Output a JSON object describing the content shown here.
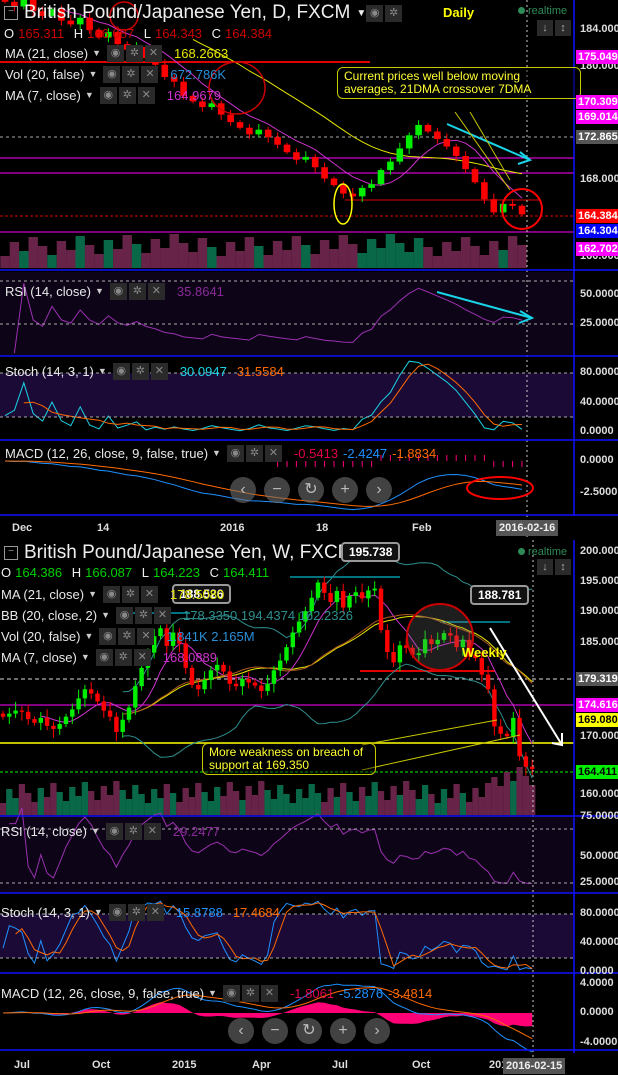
{
  "daily": {
    "title": "British Pound/Japanese Yen, D, FXCM",
    "timeframe_label": "Daily",
    "realtime": "realtime",
    "ohlc": {
      "o_label": "O",
      "o": "165.311",
      "h_label": "H",
      "h": "166.087",
      "l_label": "L",
      "l": "164.343",
      "c_label": "C",
      "c": "164.384"
    },
    "indicators": [
      {
        "label": "MA (21, close)",
        "value": "168.2663",
        "color": "#e6e600"
      },
      {
        "label": "Vol (20, false)",
        "value": "672.786K",
        "color": "#2a8fd8"
      },
      {
        "label": "MA (7, close)",
        "value": "164.9679",
        "color": "#cc33cc"
      }
    ],
    "rsi": {
      "label": "RSI (14, close)",
      "value": "35.8641"
    },
    "stoch": {
      "label": "Stoch (14, 3, 1)",
      "k": "30.0947",
      "d": "31.5584"
    },
    "macd": {
      "label": "MACD (12, 26, close, 9, false, true)",
      "hist": "-0.5413",
      "macd": "-2.4247",
      "signal": "-1.8834"
    },
    "annotation": "Current prices well below moving averages, 21DMA crossover 7DMA",
    "price_axis": [
      "184.000",
      "180.000",
      "172.000",
      "168.000",
      "160.000"
    ],
    "price_tags": [
      {
        "value": "175.049",
        "bg": "#ff00ff",
        "fg": "#ffffff"
      },
      {
        "value": "170.309",
        "bg": "#ff00ff",
        "fg": "#ffffff"
      },
      {
        "value": "169.014",
        "bg": "#ff00ff",
        "fg": "#ffffff"
      },
      {
        "value": "172.865",
        "bg": "#555555",
        "fg": "#ffffff"
      },
      {
        "value": "164.384",
        "bg": "#ff0000",
        "fg": "#ffffff"
      },
      {
        "value": "164.304",
        "bg": "#0000ff",
        "fg": "#ffffff"
      },
      {
        "value": "162.702",
        "bg": "#ff00ff",
        "fg": "#ffffff"
      }
    ],
    "rsi_axis": [
      "50.0000",
      "25.0000"
    ],
    "stoch_axis": [
      "80.0000",
      "40.0000",
      "0.0000"
    ],
    "macd_axis": [
      "0.0000",
      "-2.5000"
    ],
    "date_axis": [
      "Dec",
      "14",
      "2016",
      "18",
      "Feb"
    ],
    "cursor_date": "2016-02-16",
    "chart_data": {
      "type": "candlestick",
      "closes": [
        187,
        186.5,
        187.2,
        186,
        185.5,
        186.2,
        185,
        184.6,
        185.3,
        184,
        183.2,
        183.8,
        182.5,
        181.9,
        182.2,
        181,
        180.3,
        179,
        178.5,
        177,
        176.4,
        175.8,
        176.2,
        175,
        174.2,
        173.6,
        172.9,
        173.4,
        172.6,
        171.8,
        171,
        170.2,
        170.5,
        169.4,
        168.2,
        167.5,
        166.6,
        166.3,
        167.2,
        167.6,
        169.1,
        170,
        171.4,
        172.8,
        173.9,
        173.2,
        172.4,
        171.6,
        170.6,
        169.2,
        167.8,
        166,
        164.6,
        165.5,
        165.3,
        164.384
      ]
    }
  },
  "weekly": {
    "title": "British Pound/Japanese Yen, W, FXCM",
    "timeframe_label": "Weekly",
    "realtime": "realtime",
    "ohlc": {
      "o_label": "O",
      "o": "164.386",
      "h_label": "H",
      "h": "166.087",
      "l_label": "L",
      "l": "164.223",
      "c_label": "C",
      "c": "164.411"
    },
    "indicators": [
      {
        "label": "MA (21, close)",
        "value": "178.5080",
        "color": "#e6e600"
      },
      {
        "label": "BB (20, close, 2)",
        "value": "178.3350  194.4374  162.2326",
        "color": "#2f8f8f"
      },
      {
        "label": "Vol (20, false)",
        "value": "1.841K  2.165M",
        "color": "#2a8fd8"
      },
      {
        "label": "MA (7, close)",
        "value": "168.0889",
        "color": "#cc33cc"
      }
    ],
    "rsi": {
      "label": "RSI (14, close)",
      "value": "29.2477"
    },
    "stoch": {
      "label": "Stoch (14, 3, 1)",
      "k": "15.8788",
      "d": "17.4684"
    },
    "macd": {
      "label": "MACD (12, 26, close, 9, false, true)",
      "hist": "-1.8061",
      "macd": "-5.2876",
      "signal": "-3.4814"
    },
    "callouts": [
      "188.526",
      "195.738",
      "188.781"
    ],
    "annotation": "More weakness on breach of support at 169.350",
    "price_axis": [
      "200.000",
      "195.000",
      "190.000",
      "185.000",
      "170.000",
      "160.000"
    ],
    "price_tags": [
      {
        "value": "179.319",
        "bg": "#555555",
        "fg": "#ffffff"
      },
      {
        "value": "174.616",
        "bg": "#ff00ff",
        "fg": "#ffffff"
      },
      {
        "value": "169.080",
        "bg": "#ffff00",
        "fg": "#000000"
      },
      {
        "value": "164.411",
        "bg": "#00ee00",
        "fg": "#000000"
      }
    ],
    "rsi_axis": [
      "75.0000",
      "50.0000",
      "25.0000"
    ],
    "stoch_axis": [
      "80.0000",
      "40.0000",
      "0.0000"
    ],
    "macd_axis": [
      "4.0000",
      "0.0000",
      "-4.0000"
    ],
    "date_axis": [
      "Jul",
      "Oct",
      "2015",
      "Apr",
      "Jul",
      "Oct",
      "2016"
    ],
    "cursor_date": "2016-02-15",
    "chart_data": {
      "type": "candlestick",
      "closes": [
        173,
        173.5,
        174,
        173.8,
        172.6,
        172,
        172.8,
        171.5,
        171,
        171.8,
        173,
        174.2,
        176,
        177.5,
        176.8,
        175.5,
        174,
        173,
        170.5,
        172.5,
        174.5,
        178,
        181,
        183.5,
        186.2,
        187.5,
        184.6,
        186.8,
        185,
        181,
        178.2,
        177.5,
        179,
        180.6,
        181.5,
        180.4,
        178.4,
        178,
        179.2,
        178.6,
        178.1,
        177.2,
        178.4,
        180.6,
        182.2,
        184.4,
        186.8,
        188.6,
        190.3,
        192.5,
        195,
        193.3,
        191.8,
        193.6,
        190.9,
        192.8,
        193.4,
        192.4,
        193.7,
        194,
        187.2,
        183.6,
        181.9,
        184.7,
        184.3,
        183.1,
        183.4,
        185.7,
        184.9,
        185.6,
        186.7,
        186.3,
        184.4,
        185.6,
        183.2,
        182.6,
        179.9,
        177.5,
        171.4,
        170.2,
        169.8,
        172.8,
        166.5,
        164.8,
        164.411
      ]
    }
  },
  "nav": {
    "prev": "‹",
    "zoom_out": "−",
    "reset": "↻",
    "zoom_in": "+",
    "next": "›"
  },
  "colors": {
    "up": "#00ee00",
    "down": "#ff0000",
    "axis": "#0000ff",
    "rsi": "#9b30b0",
    "stoch_k": "#1e90ff",
    "stoch_d": "#ff6a00",
    "macd": "#1e90ff",
    "signal": "#ff6a00",
    "hist": "#ff0077"
  }
}
